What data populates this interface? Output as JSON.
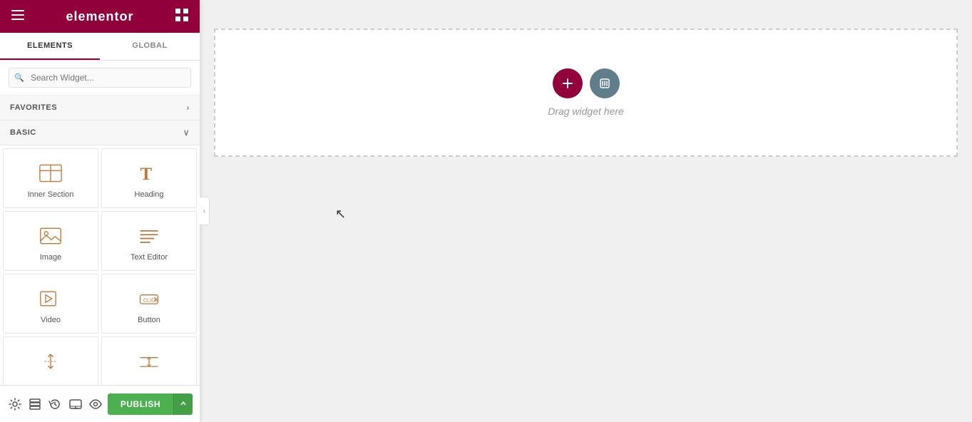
{
  "header": {
    "logo": "elementor",
    "hamburger_icon": "☰",
    "grid_icon": "⊞"
  },
  "tabs": [
    {
      "id": "elements",
      "label": "ELEMENTS",
      "active": true
    },
    {
      "id": "global",
      "label": "GLOBAL",
      "active": false
    }
  ],
  "search": {
    "placeholder": "Search Widget..."
  },
  "sections": [
    {
      "id": "favorites",
      "label": "FAVORITES",
      "expanded": false
    },
    {
      "id": "basic",
      "label": "BASIC",
      "expanded": true
    }
  ],
  "widgets": [
    {
      "id": "inner-section",
      "label": "Inner Section",
      "icon_type": "inner-section"
    },
    {
      "id": "heading",
      "label": "Heading",
      "icon_type": "heading"
    },
    {
      "id": "image",
      "label": "Image",
      "icon_type": "image"
    },
    {
      "id": "text-editor",
      "label": "Text Editor",
      "icon_type": "text-editor"
    },
    {
      "id": "video",
      "label": "Video",
      "icon_type": "video"
    },
    {
      "id": "button",
      "label": "Button",
      "icon_type": "button"
    },
    {
      "id": "divider1",
      "label": "",
      "icon_type": "spacer"
    },
    {
      "id": "divider2",
      "label": "",
      "icon_type": "divider"
    }
  ],
  "canvas": {
    "drag_text": "Drag widget here",
    "add_btn_label": "+",
    "settings_icon": "⚙"
  },
  "footer": {
    "settings_icon": "⚙",
    "layers_icon": "⧉",
    "history_icon": "↺",
    "responsive_icon": "⊡",
    "eye_icon": "👁",
    "publish_label": "PUBLISH",
    "publish_arrow": "▲"
  }
}
